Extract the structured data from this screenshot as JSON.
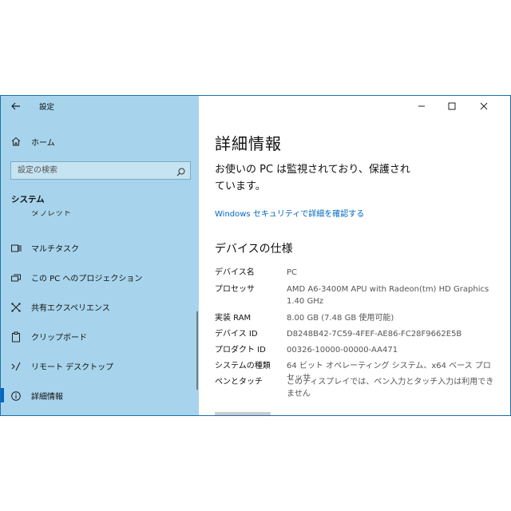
{
  "app": {
    "title": "設定"
  },
  "sidebar": {
    "home_label": "ホーム",
    "search_placeholder": "設定の検索",
    "section_title": "システム",
    "clipped_item": "タブレット",
    "items": [
      {
        "label": "マルチタスク",
        "icon": "multitask-icon"
      },
      {
        "label": "この PC へのプロジェクション",
        "icon": "projection-icon"
      },
      {
        "label": "共有エクスペリエンス",
        "icon": "shared-experience-icon"
      },
      {
        "label": "クリップボード",
        "icon": "clipboard-icon"
      },
      {
        "label": "リモート デスクトップ",
        "icon": "remote-desktop-icon"
      },
      {
        "label": "詳細情報",
        "icon": "info-icon",
        "active": true
      }
    ]
  },
  "content": {
    "title": "詳細情報",
    "protect_line1": "お使いの PC は監視されており、保護され",
    "protect_line2": "ています。",
    "security_link": "Windows セキュリティで詳細を確認する",
    "specs_title": "デバイスの仕様",
    "specs": [
      {
        "key": "デバイス名",
        "value": "PC"
      },
      {
        "key": "プロセッサ",
        "value": "AMD A6-3400M APU with Radeon(tm) HD Graphics   1.40 GHz"
      },
      {
        "key": "実装 RAM",
        "value": "8.00 GB (7.48 GB 使用可能)"
      },
      {
        "key": "デバイス ID",
        "value": "D8248B42-7C59-4FEF-AE86-FC28F9662E5B"
      },
      {
        "key": "プロダクト ID",
        "value": "00326-10000-00000-AA471"
      },
      {
        "key": "システムの種類",
        "value": "64 ビット オペレーティング システム、x64 ベース プロセッサ"
      },
      {
        "key": "ペンとタッチ",
        "value": "このディスプレイでは、ペン入力とタッチ入力は利用できません"
      }
    ]
  },
  "colors": {
    "sidebar_bg": "#a7d4ec",
    "accent": "#0067c0",
    "window_border": "#1e6fa8"
  }
}
